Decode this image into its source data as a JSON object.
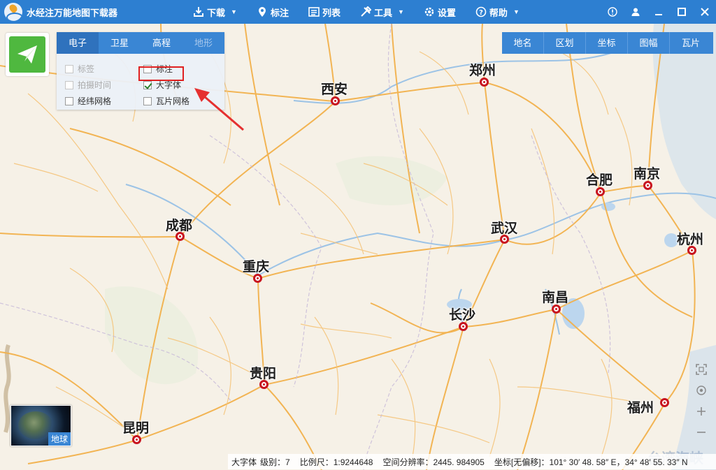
{
  "app": {
    "title": "水经注万能地图下载器"
  },
  "menu": {
    "items": [
      {
        "label": "下载",
        "icon": "download-icon",
        "dropdown": true
      },
      {
        "label": "标注",
        "icon": "pin-icon",
        "dropdown": false
      },
      {
        "label": "列表",
        "icon": "list-icon",
        "dropdown": false
      },
      {
        "label": "工具",
        "icon": "tools-icon",
        "dropdown": true
      },
      {
        "label": "设置",
        "icon": "gear-icon",
        "dropdown": false
      },
      {
        "label": "帮助",
        "icon": "help-icon",
        "dropdown": true
      }
    ]
  },
  "window_controls": [
    "info-icon",
    "user-icon",
    "minimize-icon",
    "maximize-icon",
    "close-icon"
  ],
  "layer_panel": {
    "tabs": [
      {
        "label": "电子",
        "state": "active"
      },
      {
        "label": "卫星",
        "state": "normal"
      },
      {
        "label": "高程",
        "state": "normal"
      },
      {
        "label": "地形",
        "state": "disabled"
      }
    ],
    "options": {
      "tag": {
        "label": "标签",
        "checked": false,
        "disabled": true
      },
      "shoot_time": {
        "label": "拍摄时间",
        "checked": false,
        "disabled": true
      },
      "graticule": {
        "label": "经纬网格",
        "checked": false,
        "disabled": false
      },
      "annotation": {
        "label": "标注",
        "checked": false,
        "disabled": false
      },
      "big_font": {
        "label": "大字体",
        "checked": true,
        "disabled": false
      },
      "tile_grid": {
        "label": "瓦片网格",
        "checked": false,
        "disabled": false
      }
    }
  },
  "right_toolbar": {
    "buttons": [
      "地名",
      "区划",
      "坐标",
      "图幅",
      "瓦片"
    ]
  },
  "cities": {
    "xian": "西安",
    "zhengzhou": "郑州",
    "hefei": "合肥",
    "nanjing": "南京",
    "chengdu": "成都",
    "wuhan": "武汉",
    "hangzhou": "杭州",
    "chongqing": "重庆",
    "nanchang": "南昌",
    "changsha": "长沙",
    "guiyang": "贵阳",
    "fuzhou": "福州",
    "kunming": "昆明"
  },
  "globe": {
    "label": "地球"
  },
  "watermark": "台湾海峡",
  "status": {
    "font_mode": "大字体",
    "level_label": "级别：7",
    "scale_label": "比例尺：1:9244648",
    "resolution_label": "空间分辨率：2445. 984905",
    "coord_label": "坐标[无偏移]：101° 30′ 48. 58″ E，34° 48′ 55. 33″ N"
  },
  "colors": {
    "titlebar": "#2d7fd1",
    "tab_bar": "#3a86d4",
    "road": "#f2b14c",
    "city_marker": "#c8141f",
    "checkbox_highlight": "#e02020",
    "app_icon": "#4fb83f"
  }
}
